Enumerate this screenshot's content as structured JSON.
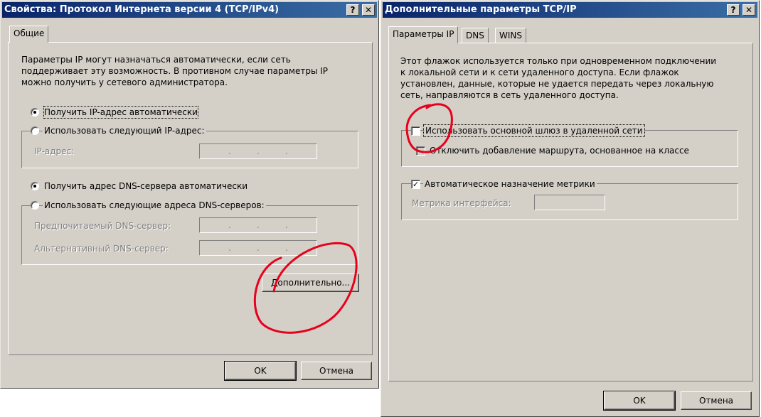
{
  "left_dialog": {
    "title": "Свойства: Протокол Интернета версии 4 (TCP/IPv4)",
    "help_button": "?",
    "close_button": "✕",
    "tab_general": "Общие",
    "intro_lines": [
      "Параметры IP могут назначаться автоматически, если сеть",
      "поддерживает эту возможность. В противном случае параметры IP",
      "можно получить у сетевого администратора."
    ],
    "radio_ip_auto": "Получить IP-адрес автоматически",
    "radio_ip_manual": "Использовать следующий IP-адрес:",
    "ip_address_label": "IP-адрес:",
    "radio_dns_auto": "Получить адрес DNS-сервера автоматически",
    "radio_dns_manual": "Использовать следующие адреса DNS-серверов:",
    "preferred_dns_label": "Предпочитаемый DNS-сервер:",
    "alternate_dns_label": "Альтернативный DNS-сервер:",
    "ip_dots": ".",
    "advanced_button": "Дополнительно...",
    "ok_button": "OK",
    "cancel_button": "Отмена"
  },
  "right_dialog": {
    "title": "Дополнительные параметры TCP/IP",
    "help_button": "?",
    "close_button": "✕",
    "tab_ip": "Параметры IP",
    "tab_dns": "DNS",
    "tab_wins": "WINS",
    "intro_lines": [
      "Этот флажок используется только при одновременном подключении",
      "к локальной сети и к сети удаленного доступа. Если флажок",
      "установлен, данные, которые не удается передать через локальную",
      "сеть, направляются в сеть удаленного доступа."
    ],
    "use_default_gateway": "Использовать основной шлюз в удаленной сети",
    "disable_class_route": "Отключить добавление маршрута, основанное на классе",
    "auto_metric": "Автоматическое назначение метрики",
    "auto_metric_checked": "✓",
    "interface_metric_label": "Метрика интерфейса:",
    "ok_button": "OK",
    "cancel_button": "Отмена"
  },
  "annotation_color": "#e8001c"
}
